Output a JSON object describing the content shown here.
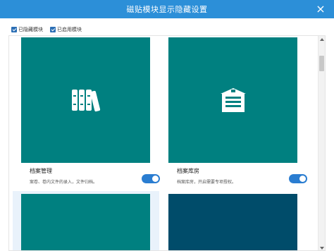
{
  "dialog": {
    "title": "磁贴模块显示隐藏设置",
    "close_label": "×"
  },
  "filters": [
    {
      "label": "已隐藏模块",
      "checked": true
    },
    {
      "label": "已启用模块",
      "checked": true
    }
  ],
  "cards": [
    {
      "name": "档案管理",
      "desc": "案卷、卷内文件的录入，文件归档。",
      "icon": "archive-books-icon",
      "tile_color": "#008080",
      "enabled": true
    },
    {
      "name": "档案库房",
      "desc": "档案库房，开启需要专项授权。",
      "icon": "archive-storage-icon",
      "tile_color": "#008080",
      "enabled": true
    },
    {
      "tile_color": "#008080"
    },
    {
      "tile_color": "#004c6a"
    }
  ],
  "colors": {
    "titlebar": "#2c8fd8",
    "toggle_on": "#2a7dd1"
  }
}
